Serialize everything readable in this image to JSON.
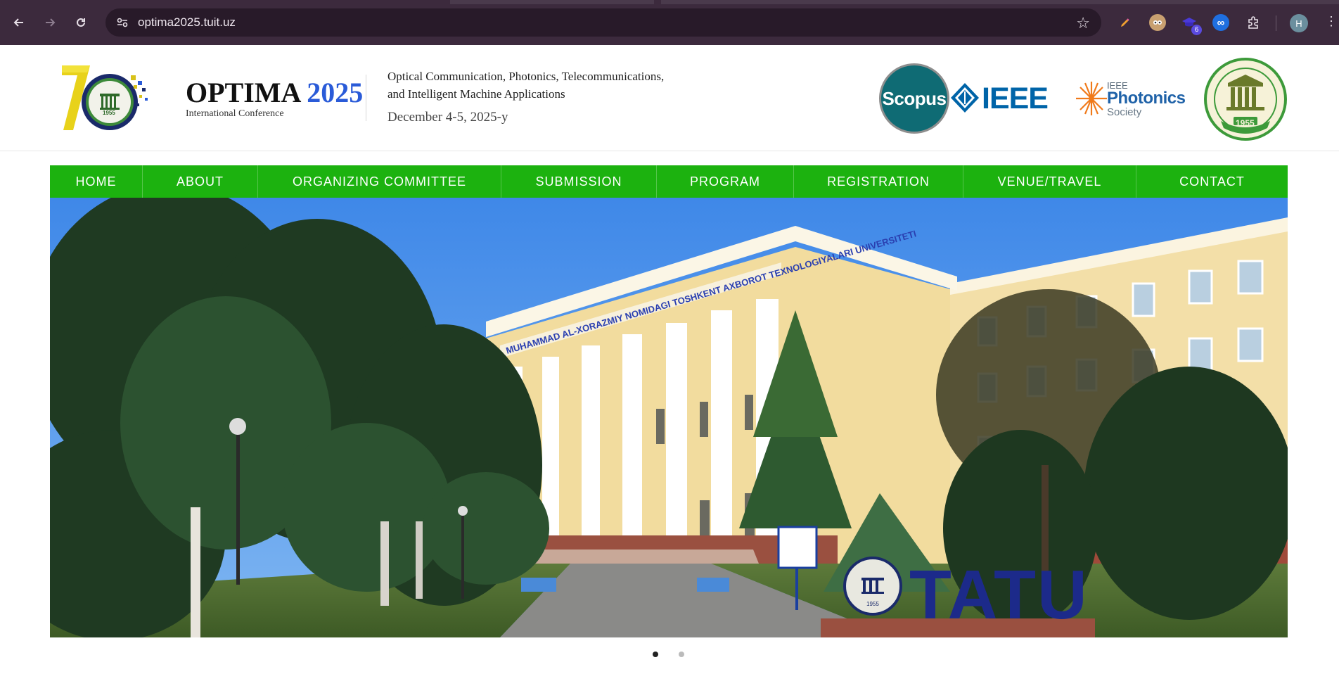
{
  "browser": {
    "url": "optima2025.tuit.uz",
    "avatar_letter": "H",
    "extension_badge": "6"
  },
  "header": {
    "logo_number": "70",
    "logo_year": "1955",
    "brand_name": "OPTIMA",
    "brand_year": "2025",
    "brand_subtitle": "International Conference",
    "conf_line1": "Optical Communication, Photonics, Telecommunications,",
    "conf_line2": "and Intelligent Machine Applications",
    "conf_date": "December 4-5, 2025-y",
    "scopus_label": "Scopus",
    "ieee_label": "IEEE",
    "photonics_top": "IEEE",
    "photonics_main": "Photonics",
    "photonics_society": "Society",
    "university_logo_year": "1955"
  },
  "nav": {
    "items": [
      {
        "label": "HOME"
      },
      {
        "label": "ABOUT"
      },
      {
        "label": "ORGANIZING COMMITTEE"
      },
      {
        "label": "SUBMISSION"
      },
      {
        "label": "PROGRAM"
      },
      {
        "label": "REGISTRATION"
      },
      {
        "label": "VENUE/TRAVEL"
      },
      {
        "label": "CONTACT"
      }
    ]
  },
  "hero": {
    "building_sign": "MUHAMMAD AL-XORAZMIY NOMIDAGI TOSHKENT AXBOROT TEXNOLOGIYALARI UNIVERSITETI",
    "monument_text": "TATU",
    "monument_logo_year": "1955"
  },
  "slider": {
    "active_index": 0,
    "count": 2
  },
  "colors": {
    "nav_green": "#1cb20f",
    "brand_blue": "#2a5bd8",
    "scopus_teal": "#0f6b74",
    "ieee_blue": "#0064a8"
  }
}
